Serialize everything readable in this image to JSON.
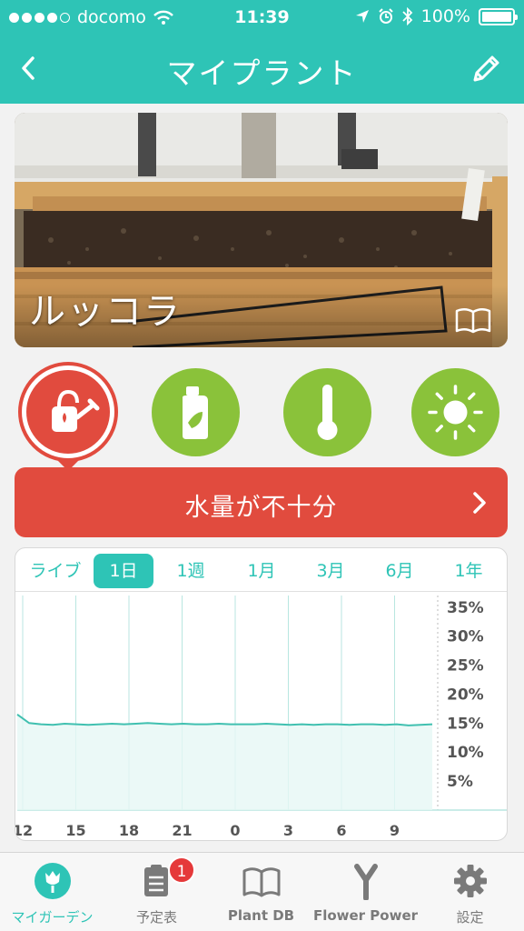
{
  "status_bar": {
    "carrier": "docomo",
    "time": "11:39",
    "battery": "100%"
  },
  "nav": {
    "title": "マイプラント",
    "back_icon": "chevron-left-icon",
    "edit_icon": "pencil-icon"
  },
  "plant": {
    "name": "ルッコラ",
    "guide_icon": "book-icon"
  },
  "sensors": [
    {
      "name": "water",
      "icon": "watering-can-icon",
      "state": "alert",
      "color": "#e14b3e"
    },
    {
      "name": "fertilizer",
      "icon": "fertilizer-bottle-icon",
      "state": "ok",
      "color": "#8ac23a"
    },
    {
      "name": "temperature",
      "icon": "thermometer-icon",
      "state": "ok",
      "color": "#8ac23a"
    },
    {
      "name": "light",
      "icon": "sun-icon",
      "state": "ok",
      "color": "#8ac23a"
    }
  ],
  "alert": {
    "text": "水量が不十分"
  },
  "range_tabs": [
    "ライブ",
    "1日",
    "1週",
    "1月",
    "3月",
    "6月",
    "1年"
  ],
  "active_range": "1日",
  "chart_data": {
    "type": "line",
    "x": [
      "12",
      "15",
      "18",
      "21",
      "0",
      "3",
      "6",
      "9"
    ],
    "ylabels": [
      "35%",
      "30%",
      "25%",
      "20%",
      "15%",
      "10%",
      "5%"
    ],
    "ylim": [
      0,
      37
    ],
    "series": [
      {
        "values": [
          16.5,
          15.0,
          14.8,
          14.7,
          14.9,
          14.8,
          14.7,
          14.8,
          14.9,
          14.8,
          14.9,
          15.0,
          14.9,
          14.8,
          14.9,
          14.8,
          14.8,
          14.9,
          14.8,
          14.8,
          14.8,
          14.9,
          14.8,
          14.7,
          14.8,
          14.7,
          14.8,
          14.8,
          14.7,
          14.8,
          14.8,
          14.7,
          14.8,
          14.6,
          14.7,
          14.8
        ]
      }
    ],
    "grid": true,
    "line_color": "#40c0b0"
  },
  "tabbar": [
    {
      "label": "マイガーデン",
      "icon": "flower-icon",
      "active": true
    },
    {
      "label": "予定表",
      "icon": "clipboard-icon",
      "badge": "1"
    },
    {
      "label": "Plant DB",
      "icon": "book-icon"
    },
    {
      "label": "Flower Power",
      "icon": "flower-power-sensor-icon"
    },
    {
      "label": "設定",
      "icon": "gear-icon"
    }
  ]
}
